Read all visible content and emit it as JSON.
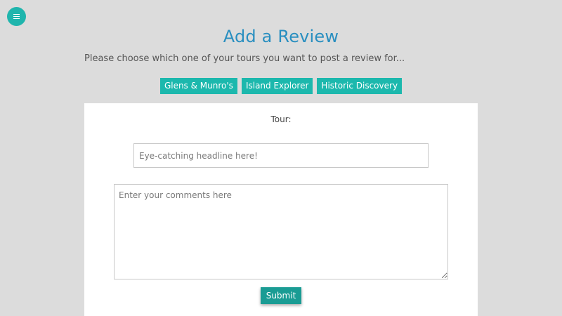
{
  "menu": {
    "icon": "hamburger-menu-icon"
  },
  "page": {
    "title": "Add a Review",
    "instructions": "Please choose which one of your tours you want to post a review for..."
  },
  "tours": [
    {
      "label": "Glens & Munro's"
    },
    {
      "label": "Island Explorer"
    },
    {
      "label": "Historic Discovery"
    }
  ],
  "form": {
    "tour_label": "Tour:",
    "headline_placeholder": "Eye-catching headline here!",
    "comments_placeholder": "Enter your comments here",
    "submit_label": "Submit"
  },
  "colors": {
    "accent": "#1cb8ad",
    "title": "#2a8fc0",
    "background": "#dcdcdc"
  }
}
